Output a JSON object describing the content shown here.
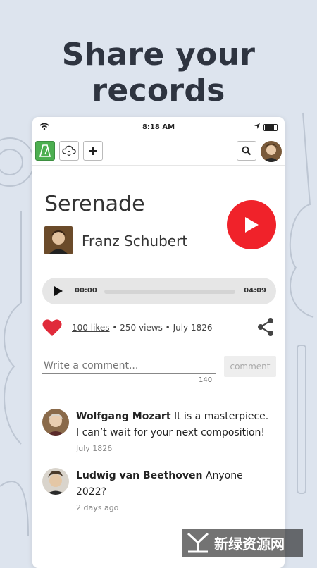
{
  "headline": "Share your records",
  "status": {
    "time": "8:18 AM"
  },
  "toolbar": {
    "metronome_icon": "metronome-icon",
    "cloud_icon": "cloud-sync-icon",
    "add_icon": "plus-icon",
    "search_icon": "search-icon"
  },
  "song": {
    "title": "Serenade",
    "composer": "Franz Schubert"
  },
  "player": {
    "current": "00:00",
    "duration": "04:09",
    "progress": 0
  },
  "stats": {
    "likes": "100 likes",
    "rest": " • 250 views • July 1826"
  },
  "comment_form": {
    "placeholder": "Write a comment...",
    "button": "comment",
    "remaining": "140"
  },
  "comments": [
    {
      "author": "Wolfgang Mozart",
      "text": " It is a masterpiece. I can’t wait for your next composition!",
      "date": "July 1826"
    },
    {
      "author": "Ludwig van Beethoven",
      "text": " Anyone 2022?",
      "date": "2 days ago"
    }
  ],
  "watermark": "新绿资源网",
  "colors": {
    "accent_red": "#f0222a",
    "green": "#4caf50",
    "background": "#dde4ee"
  }
}
